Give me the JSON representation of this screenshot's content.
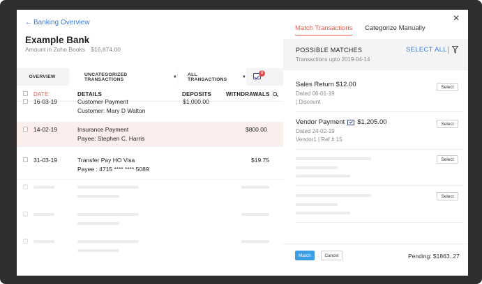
{
  "header": {
    "back_label": "Banking Overview",
    "bank_name": "Example Bank",
    "amount_label": "Amount in Zoho Books",
    "amount_value": "$16,874.00"
  },
  "filters": {
    "overview": "OVERVIEW",
    "uncategorized": "UNCATEGORIZED TRANSACTIONS",
    "all": "ALL TRANSACTIONS",
    "badge_count": "8"
  },
  "table": {
    "columns": {
      "date": "DATE",
      "details": "DETAILS",
      "deposits": "DEPOSITS",
      "withdrawals": "WITHDRAWALS"
    },
    "rows": [
      {
        "date": "16-03-19",
        "detail1": "Customer Payment",
        "detail2": "Customer: Mary D Walton",
        "deposit": "$1,000.00",
        "withdrawal": ""
      },
      {
        "date": "14-02-19",
        "detail1": "Insurance Payment",
        "detail2": "Payee: Stephen C. Harris",
        "deposit": "",
        "withdrawal": "$800.00"
      },
      {
        "date": "31-03-19",
        "detail1": "Transfer Pay HO Visa",
        "detail2": "Payee : 4715 **** **** 5089",
        "deposit": "",
        "withdrawal": "$19.75"
      }
    ]
  },
  "panel": {
    "tabs": [
      "Match Transactions",
      "Categorize Manually"
    ],
    "possible_matches_title": "POSSIBLE MATCHES",
    "possible_matches_sub": "Transactions upto 2019-04-14",
    "select_all": "SELECT ALL",
    "matches": [
      {
        "title": "Sales Return $12.00",
        "line1": "Dated 06-01-19",
        "line2": "| Discount",
        "button": "Select"
      },
      {
        "title": "Vendor Payment",
        "amount": "$1,205.00",
        "line1": "Dated 24-02-19",
        "line2": "Vendor1 | Ref # 15",
        "button": "Select"
      }
    ],
    "placeholder_button": "Select",
    "match_button": "Match",
    "cancel_button": "Cancel",
    "pending": "Pending: $1863..27"
  },
  "colors": {
    "accent_red": "#e05b4b",
    "link_blue": "#3a7bd5",
    "highlight_row": "#fdeeee",
    "match_button": "#3a9ee5"
  }
}
